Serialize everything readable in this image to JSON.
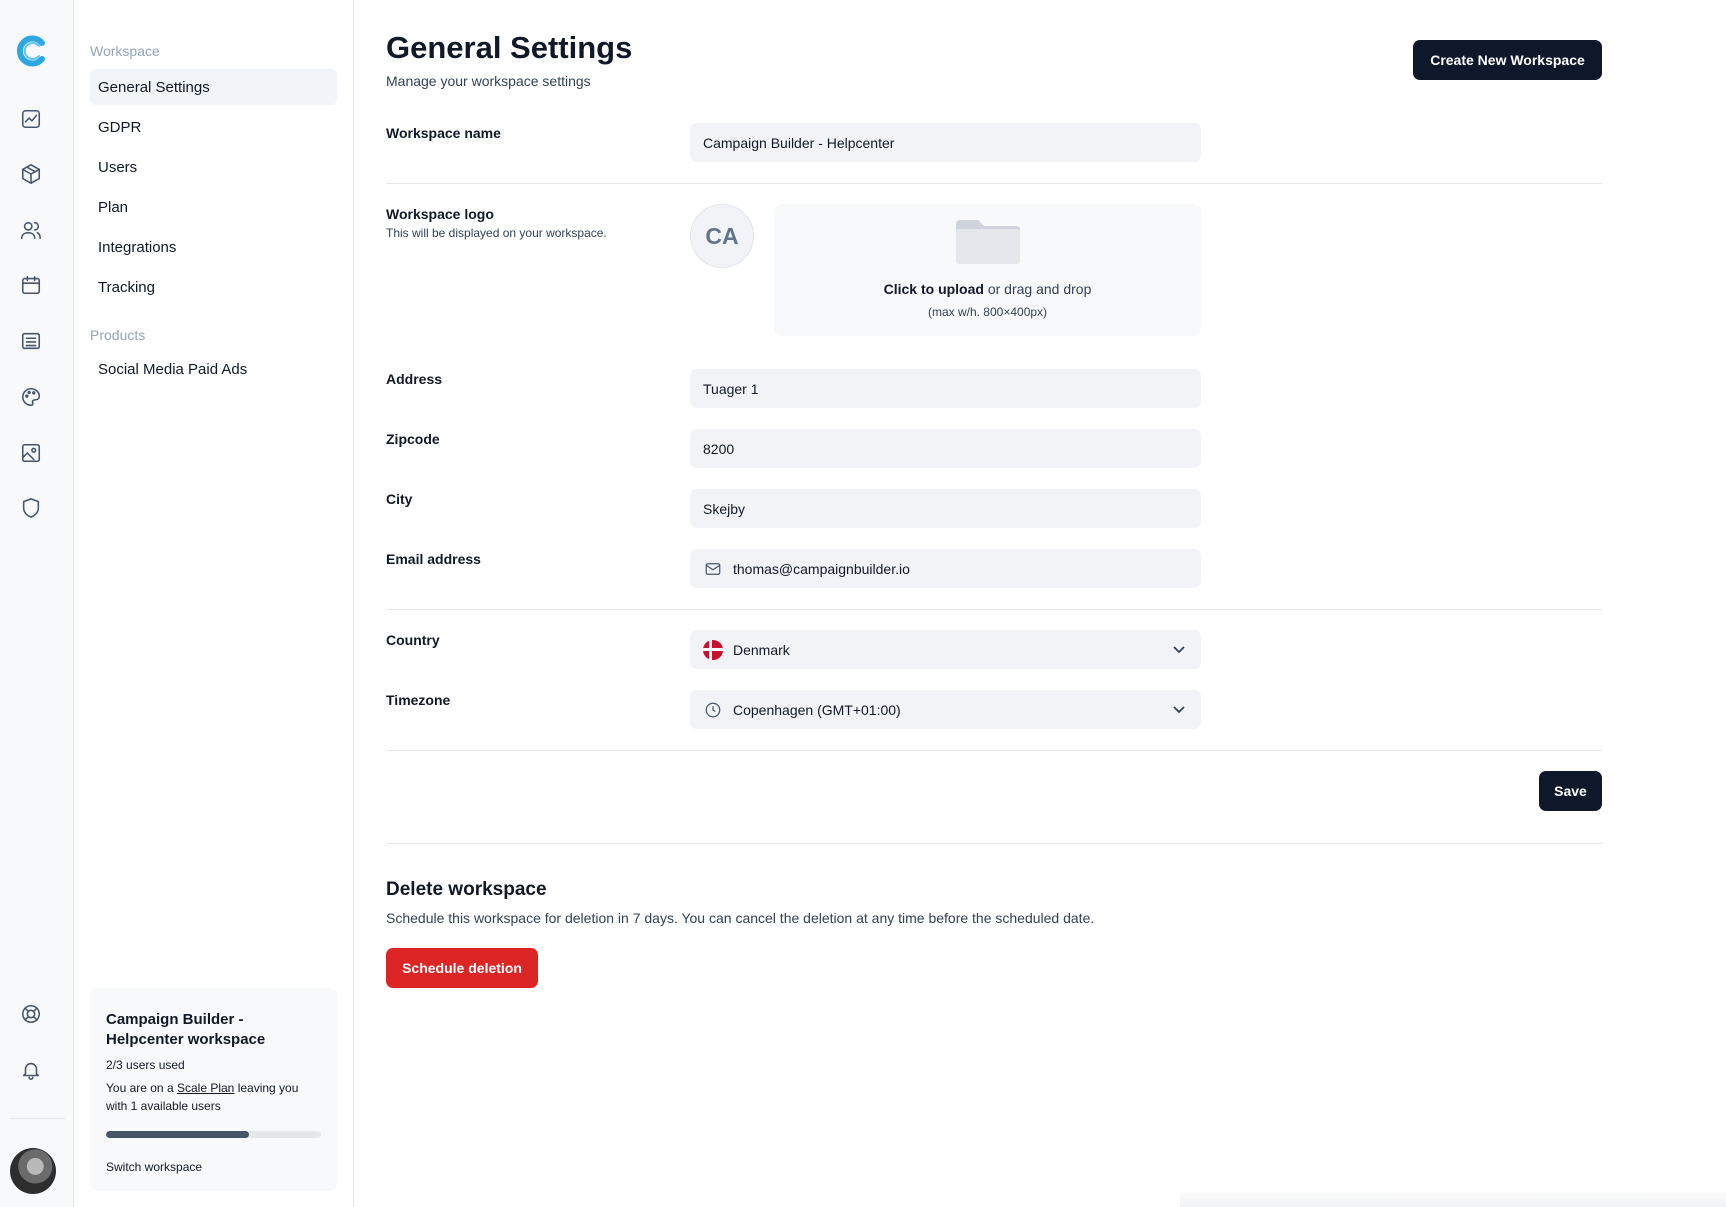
{
  "colors": {
    "primary_dark": "#0f172a",
    "danger": "#dc2626",
    "logo_blue": "#2ea7e0",
    "field_bg": "#f1f3f6"
  },
  "rail": {
    "icons": [
      "dashboard-icon",
      "box-icon",
      "users-icon",
      "calendar-icon",
      "list-icon",
      "palette-icon",
      "image-icon",
      "shield-icon"
    ],
    "bottom_icons": [
      "help-lifebuoy-icon",
      "bell-icon"
    ]
  },
  "sidebar": {
    "section_workspace": "Workspace",
    "items": [
      {
        "label": "General Settings",
        "active": true
      },
      {
        "label": "GDPR"
      },
      {
        "label": "Users"
      },
      {
        "label": "Plan"
      },
      {
        "label": "Integrations"
      },
      {
        "label": "Tracking"
      }
    ],
    "section_products": "Products",
    "product_items": [
      {
        "label": "Social Media Paid Ads"
      }
    ],
    "workspace_card": {
      "title": "Campaign Builder - Helpcenter workspace",
      "users_used": "2/3 users used",
      "desc_prefix": "You are on a",
      "plan_link": "Scale Plan",
      "desc_suffix": "leaving you with 1 available users",
      "usage_fraction": 0.667,
      "switch_label": "Switch workspace"
    }
  },
  "header": {
    "title": "General Settings",
    "subtitle": "Manage your workspace settings",
    "create_button": "Create New Workspace"
  },
  "form": {
    "workspace_name": {
      "label": "Workspace name",
      "value": "Campaign Builder - Helpcenter"
    },
    "workspace_logo": {
      "label": "Workspace logo",
      "help": "This will be displayed on your workspace.",
      "initials": "CA",
      "upload_link": "Click to upload",
      "upload_text": "or drag and drop",
      "upload_hint": "(max w/h. 800×400px)"
    },
    "address": {
      "label": "Address",
      "value": "Tuager 1"
    },
    "zipcode": {
      "label": "Zipcode",
      "value": "8200"
    },
    "city": {
      "label": "City",
      "value": "Skejby"
    },
    "email": {
      "label": "Email address",
      "value": "thomas@campaignbuilder.io"
    },
    "country": {
      "label": "Country",
      "value": "Denmark"
    },
    "timezone": {
      "label": "Timezone",
      "value": "Copenhagen (GMT+01:00)"
    },
    "save_button": "Save"
  },
  "delete_section": {
    "title": "Delete workspace",
    "description": "Schedule this workspace for deletion in 7 days. You can cancel the deletion at any time before the scheduled date.",
    "button": "Schedule deletion"
  }
}
